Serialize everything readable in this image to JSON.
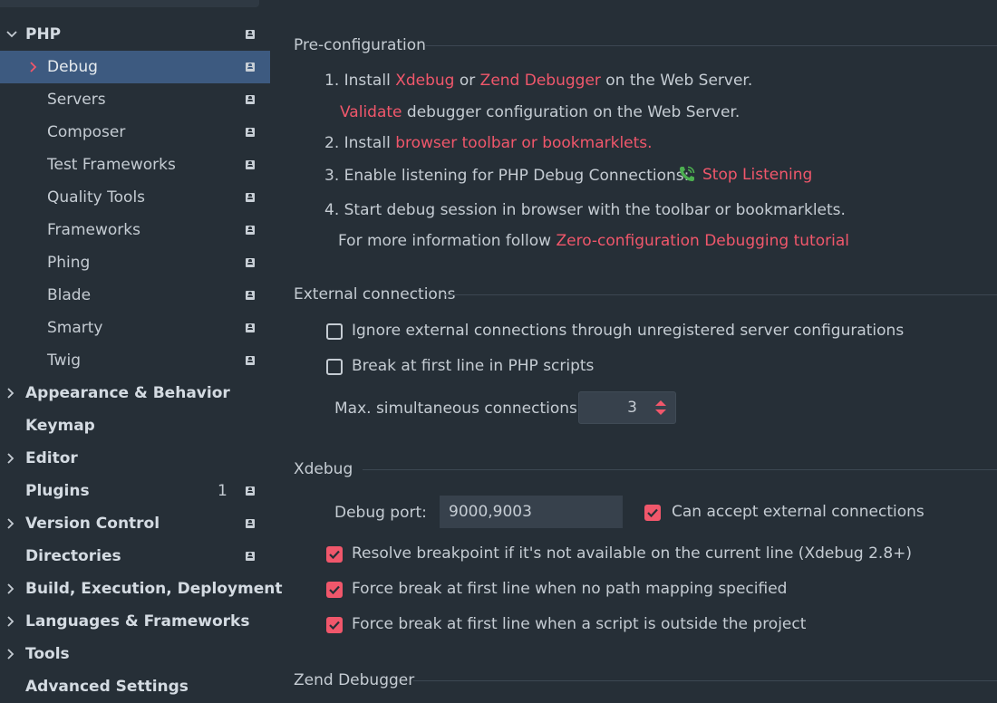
{
  "sidebar": {
    "items": [
      {
        "label": "PHP"
      },
      {
        "label": "Debug"
      },
      {
        "label": "Servers"
      },
      {
        "label": "Composer"
      },
      {
        "label": "Test Frameworks"
      },
      {
        "label": "Quality Tools"
      },
      {
        "label": "Frameworks"
      },
      {
        "label": "Phing"
      },
      {
        "label": "Blade"
      },
      {
        "label": "Smarty"
      },
      {
        "label": "Twig"
      },
      {
        "label": "Appearance & Behavior"
      },
      {
        "label": "Keymap"
      },
      {
        "label": "Editor"
      },
      {
        "label": "Plugins",
        "count": "1"
      },
      {
        "label": "Version Control"
      },
      {
        "label": "Directories"
      },
      {
        "label": "Build, Execution, Deployment"
      },
      {
        "label": "Languages & Frameworks"
      },
      {
        "label": "Tools"
      },
      {
        "label": "Advanced Settings"
      }
    ]
  },
  "preconfig": {
    "title": "Pre-configuration",
    "step1_prefix": "1. Install ",
    "xdebug_link": "Xdebug",
    "or": " or ",
    "zend_link": "Zend Debugger",
    "step1_suffix": " on the Web Server.",
    "validate_link": "Validate",
    "validate_suffix": " debugger configuration on the Web Server.",
    "step2_prefix": "2. Install ",
    "toolbar_link": "browser toolbar or bookmarklets.",
    "step3": "3. Enable listening for PHP Debug Connections:",
    "stop_listening": "Stop Listening",
    "step4": "4. Start debug session in browser with the toolbar or bookmarklets.",
    "more_info": "For more information follow ",
    "tutorial_link": "Zero-configuration Debugging tutorial"
  },
  "external": {
    "title": "External connections",
    "ignore_label": "Ignore external connections through unregistered server configurations",
    "ignore_checked": false,
    "break_label": "Break at first line in PHP scripts",
    "break_checked": false,
    "max_label": "Max. simultaneous connections:",
    "max_value": "3"
  },
  "xdebug": {
    "title": "Xdebug",
    "port_label": "Debug port:",
    "port_value": "9000,9003",
    "accept_label": "Can accept external connections",
    "accept_checked": true,
    "resolve_label": "Resolve breakpoint if it's not available on the current line (Xdebug 2.8+)",
    "resolve_checked": true,
    "force_path_label": "Force break at first line when no path mapping specified",
    "force_path_checked": true,
    "force_outside_label": "Force break at first line when a script is outside the project",
    "force_outside_checked": true
  },
  "zend": {
    "title": "Zend Debugger"
  },
  "colors": {
    "accent": "#f0576b",
    "selection": "#3d5a80",
    "background": "#262f37",
    "phone_icon": "#4caf50"
  }
}
